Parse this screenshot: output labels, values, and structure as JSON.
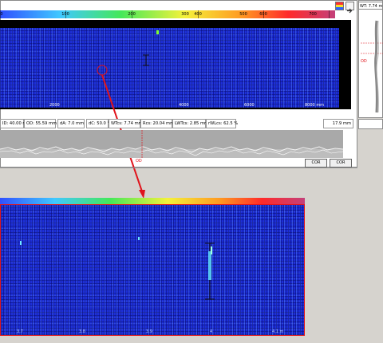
{
  "top_scale": {
    "ticks": [
      "0",
      "100",
      "200",
      "300",
      "400",
      "500",
      "600",
      "700"
    ]
  },
  "scan": {
    "x_labels": [
      "2000",
      "4000",
      "6000",
      "8000 mm"
    ],
    "colors": {
      "background": "#1d2fd8",
      "marker": "#e0141c"
    }
  },
  "info_bar": {
    "id": "ID: 40.00 mm",
    "od": "OD: 55.59 mm",
    "da": "dA: 7.0 mm",
    "dc": "dC: 50.0 °",
    "wt": "WTcs: 7.74 mm",
    "rcs": "Rcs: 20.04 mm",
    "lwt": "LWTcs: 2.85 mm",
    "rwl": "rWLcs: 62.5 %",
    "depth": "17.9 mm"
  },
  "profile": {
    "od_label": "OD",
    "cor_left": "COR",
    "cor_right": "COR"
  },
  "right_panel": {
    "wt_readout": "WT: 7.74 mm",
    "od_label": "OD"
  },
  "zoom": {
    "x_labels": [
      "3.7",
      "3.8",
      "3.9",
      "4",
      "4.1 m"
    ]
  }
}
